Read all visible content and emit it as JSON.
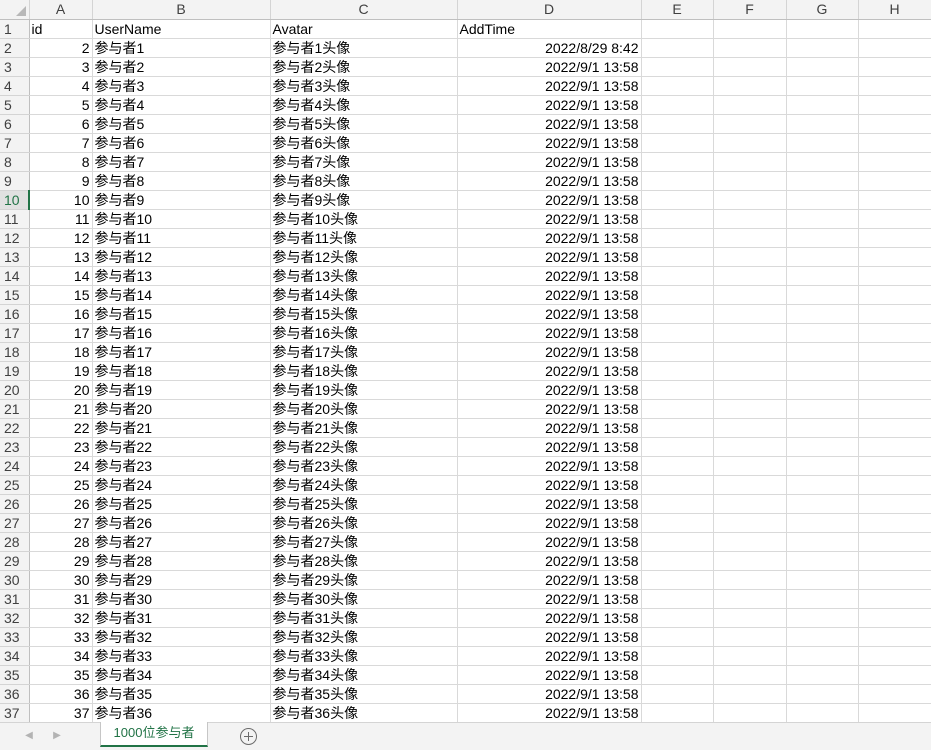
{
  "columns": [
    "A",
    "B",
    "C",
    "D",
    "E",
    "F",
    "G",
    "H"
  ],
  "header_row": {
    "row_number": "1",
    "id": "id",
    "username": "UserName",
    "avatar": "Avatar",
    "addtime": "AddTime"
  },
  "rows": [
    {
      "row": "2",
      "id": "2",
      "username": "参与者1",
      "avatar": "参与者1头像",
      "addtime": "2022/8/29 8:42"
    },
    {
      "row": "3",
      "id": "3",
      "username": "参与者2",
      "avatar": "参与者2头像",
      "addtime": "2022/9/1 13:58"
    },
    {
      "row": "4",
      "id": "4",
      "username": "参与者3",
      "avatar": "参与者3头像",
      "addtime": "2022/9/1 13:58"
    },
    {
      "row": "5",
      "id": "5",
      "username": "参与者4",
      "avatar": "参与者4头像",
      "addtime": "2022/9/1 13:58"
    },
    {
      "row": "6",
      "id": "6",
      "username": "参与者5",
      "avatar": "参与者5头像",
      "addtime": "2022/9/1 13:58"
    },
    {
      "row": "7",
      "id": "7",
      "username": "参与者6",
      "avatar": "参与者6头像",
      "addtime": "2022/9/1 13:58"
    },
    {
      "row": "8",
      "id": "8",
      "username": "参与者7",
      "avatar": "参与者7头像",
      "addtime": "2022/9/1 13:58"
    },
    {
      "row": "9",
      "id": "9",
      "username": "参与者8",
      "avatar": "参与者8头像",
      "addtime": "2022/9/1 13:58"
    },
    {
      "row": "10",
      "id": "10",
      "username": "参与者9",
      "avatar": "参与者9头像",
      "addtime": "2022/9/1 13:58"
    },
    {
      "row": "11",
      "id": "11",
      "username": "参与者10",
      "avatar": "参与者10头像",
      "addtime": "2022/9/1 13:58"
    },
    {
      "row": "12",
      "id": "12",
      "username": "参与者11",
      "avatar": "参与者11头像",
      "addtime": "2022/9/1 13:58"
    },
    {
      "row": "13",
      "id": "13",
      "username": "参与者12",
      "avatar": "参与者12头像",
      "addtime": "2022/9/1 13:58"
    },
    {
      "row": "14",
      "id": "14",
      "username": "参与者13",
      "avatar": "参与者13头像",
      "addtime": "2022/9/1 13:58"
    },
    {
      "row": "15",
      "id": "15",
      "username": "参与者14",
      "avatar": "参与者14头像",
      "addtime": "2022/9/1 13:58"
    },
    {
      "row": "16",
      "id": "16",
      "username": "参与者15",
      "avatar": "参与者15头像",
      "addtime": "2022/9/1 13:58"
    },
    {
      "row": "17",
      "id": "17",
      "username": "参与者16",
      "avatar": "参与者16头像",
      "addtime": "2022/9/1 13:58"
    },
    {
      "row": "18",
      "id": "18",
      "username": "参与者17",
      "avatar": "参与者17头像",
      "addtime": "2022/9/1 13:58"
    },
    {
      "row": "19",
      "id": "19",
      "username": "参与者18",
      "avatar": "参与者18头像",
      "addtime": "2022/9/1 13:58"
    },
    {
      "row": "20",
      "id": "20",
      "username": "参与者19",
      "avatar": "参与者19头像",
      "addtime": "2022/9/1 13:58"
    },
    {
      "row": "21",
      "id": "21",
      "username": "参与者20",
      "avatar": "参与者20头像",
      "addtime": "2022/9/1 13:58"
    },
    {
      "row": "22",
      "id": "22",
      "username": "参与者21",
      "avatar": "参与者21头像",
      "addtime": "2022/9/1 13:58"
    },
    {
      "row": "23",
      "id": "23",
      "username": "参与者22",
      "avatar": "参与者22头像",
      "addtime": "2022/9/1 13:58"
    },
    {
      "row": "24",
      "id": "24",
      "username": "参与者23",
      "avatar": "参与者23头像",
      "addtime": "2022/9/1 13:58"
    },
    {
      "row": "25",
      "id": "25",
      "username": "参与者24",
      "avatar": "参与者24头像",
      "addtime": "2022/9/1 13:58"
    },
    {
      "row": "26",
      "id": "26",
      "username": "参与者25",
      "avatar": "参与者25头像",
      "addtime": "2022/9/1 13:58"
    },
    {
      "row": "27",
      "id": "27",
      "username": "参与者26",
      "avatar": "参与者26头像",
      "addtime": "2022/9/1 13:58"
    },
    {
      "row": "28",
      "id": "28",
      "username": "参与者27",
      "avatar": "参与者27头像",
      "addtime": "2022/9/1 13:58"
    },
    {
      "row": "29",
      "id": "29",
      "username": "参与者28",
      "avatar": "参与者28头像",
      "addtime": "2022/9/1 13:58"
    },
    {
      "row": "30",
      "id": "30",
      "username": "参与者29",
      "avatar": "参与者29头像",
      "addtime": "2022/9/1 13:58"
    },
    {
      "row": "31",
      "id": "31",
      "username": "参与者30",
      "avatar": "参与者30头像",
      "addtime": "2022/9/1 13:58"
    },
    {
      "row": "32",
      "id": "32",
      "username": "参与者31",
      "avatar": "参与者31头像",
      "addtime": "2022/9/1 13:58"
    },
    {
      "row": "33",
      "id": "33",
      "username": "参与者32",
      "avatar": "参与者32头像",
      "addtime": "2022/9/1 13:58"
    },
    {
      "row": "34",
      "id": "34",
      "username": "参与者33",
      "avatar": "参与者33头像",
      "addtime": "2022/9/1 13:58"
    },
    {
      "row": "35",
      "id": "35",
      "username": "参与者34",
      "avatar": "参与者34头像",
      "addtime": "2022/9/1 13:58"
    },
    {
      "row": "36",
      "id": "36",
      "username": "参与者35",
      "avatar": "参与者35头像",
      "addtime": "2022/9/1 13:58"
    },
    {
      "row": "37",
      "id": "37",
      "username": "参与者36",
      "avatar": "参与者36头像",
      "addtime": "2022/9/1 13:58"
    }
  ],
  "active_row": "10",
  "sheet_tab": {
    "label": "1000位参与者"
  },
  "icons": {
    "prev": "chevron-left-icon",
    "next": "chevron-right-icon",
    "add": "add-sheet-icon"
  },
  "colors": {
    "accent": "#217346",
    "header_bg": "#f3f3f3",
    "gridline": "#d9d9d9"
  }
}
